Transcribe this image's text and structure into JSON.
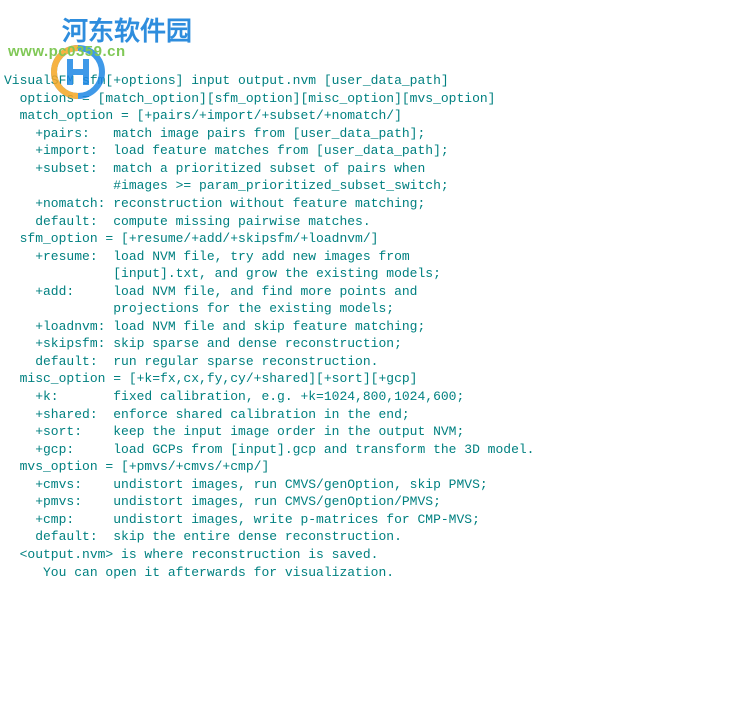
{
  "lines": [
    {
      "text": "VisualSFM sfm[+options] input output.nvm [user_data_path]",
      "cut": true
    },
    {
      "text": "  options = [match_option][sfm_option][misc_option][mvs_option]"
    },
    {
      "text": "  match_option = [+pairs/+import/+subset/+nomatch/]"
    },
    {
      "text": "    +pairs:   match image pairs from [user_data_path];"
    },
    {
      "text": "    +import:  load feature matches from [user_data_path];"
    },
    {
      "text": "    +subset:  match a prioritized subset of pairs when"
    },
    {
      "text": "              #images >= param_prioritized_subset_switch;"
    },
    {
      "text": "    +nomatch: reconstruction without feature matching;"
    },
    {
      "text": "    default:  compute missing pairwise matches."
    },
    {
      "text": "  sfm_option = [+resume/+add/+skipsfm/+loadnvm/]"
    },
    {
      "text": "    +resume:  load NVM file, try add new images from"
    },
    {
      "text": "              [input].txt, and grow the existing models;"
    },
    {
      "text": "    +add:     load NVM file, and find more points and"
    },
    {
      "text": "              projections for the existing models;"
    },
    {
      "text": "    +loadnvm: load NVM file and skip feature matching;"
    },
    {
      "text": "    +skipsfm: skip sparse and dense reconstruction;"
    },
    {
      "text": "    default:  run regular sparse reconstruction."
    },
    {
      "text": "  misc_option = [+k=fx,cx,fy,cy/+shared][+sort][+gcp]"
    },
    {
      "text": "    +k:       fixed calibration, e.g. +k=1024,800,1024,600;"
    },
    {
      "text": "    +shared:  enforce shared calibration in the end;"
    },
    {
      "text": "    +sort:    keep the input image order in the output NVM;"
    },
    {
      "text": "    +gcp:     load GCPs from [input].gcp and transform the 3D model."
    },
    {
      "text": "  mvs_option = [+pmvs/+cmvs/+cmp/]"
    },
    {
      "text": "    +cmvs:    undistort images, run CMVS/genOption, skip PMVS;"
    },
    {
      "text": "    +pmvs:    undistort images, run CMVS/genOption/PMVS;"
    },
    {
      "text": "    +cmp:     undistort images, write p-matrices for CMP-MVS;"
    },
    {
      "text": "    default:  skip the entire dense reconstruction."
    },
    {
      "text": "  <output.nvm> is where reconstruction is saved."
    },
    {
      "text": "     You can open it afterwards for visualization."
    }
  ],
  "watermark": {
    "cn": "河东软件园",
    "url": "www.pc0359.cn"
  }
}
